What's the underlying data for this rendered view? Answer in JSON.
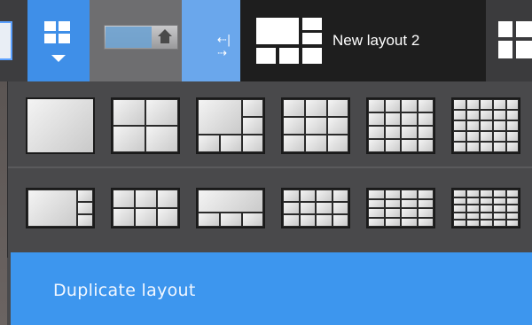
{
  "toolbar": {
    "active_tab_title": "New layout 2",
    "icons": {
      "layouts_menu": "grid-2x2-icon",
      "dropdown": "triangle-down-icon",
      "home": "home-icon",
      "splitter": "split-resize-icon"
    },
    "zoom_slider_level_percent": 63
  },
  "layout_menu": {
    "row1": [
      "1x1",
      "2x2",
      "1+5",
      "2x3",
      "3x4",
      "4x5"
    ],
    "row2": [
      "1+2 side",
      "2x3 wide",
      "1+3 bottom",
      "2x4",
      "3x4 wide",
      "4x5 wide"
    ]
  },
  "context_menu": {
    "duplicate_label": "Duplicate layout"
  },
  "colors": {
    "accent": "#3d96ee",
    "toolbar_bg": "#2b2b2b",
    "menu_bg": "#49494b"
  }
}
